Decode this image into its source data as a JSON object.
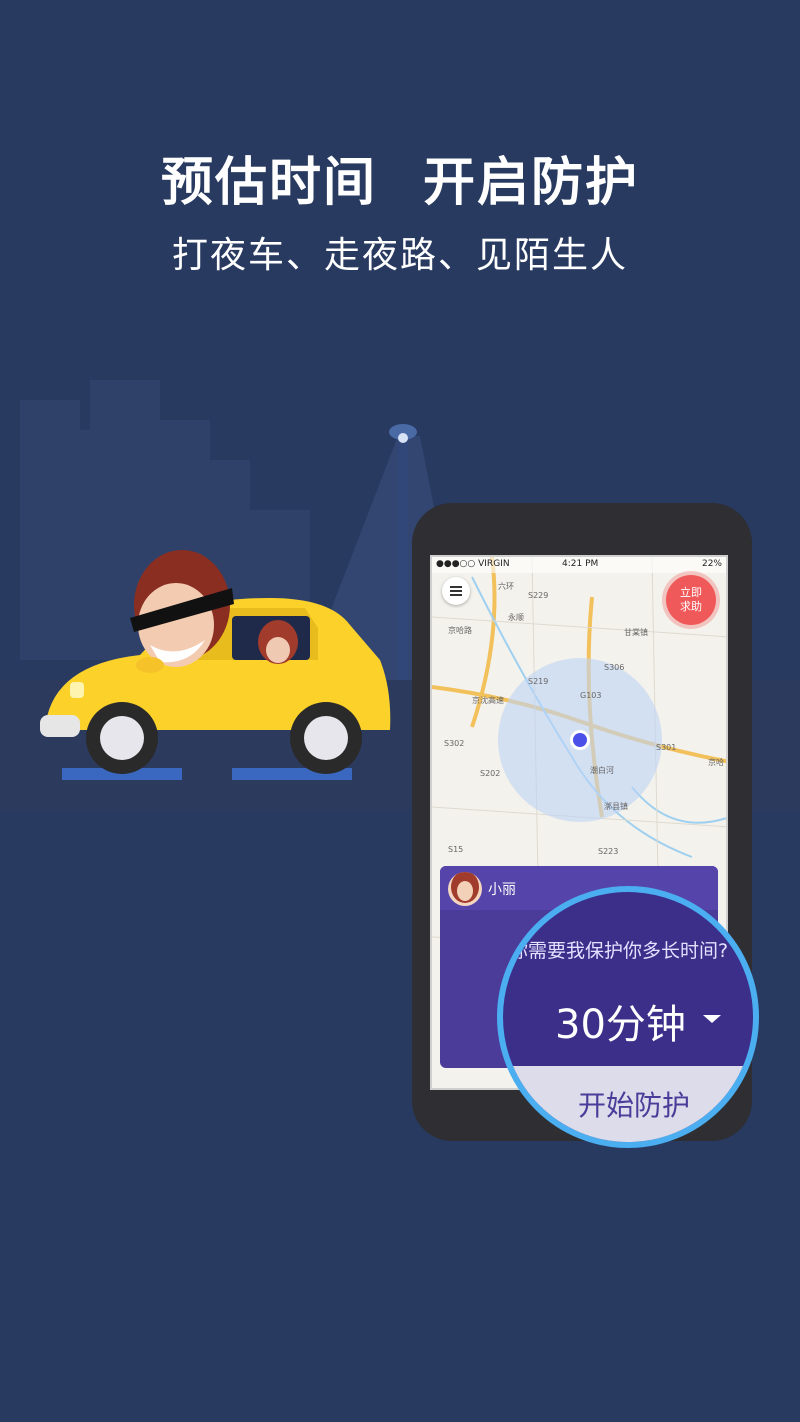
{
  "hero": {
    "headline_left": "预估时间",
    "headline_right": "开启防护",
    "subline": "打夜车、走夜路、见陌生人"
  },
  "phone": {
    "status": {
      "carrier": "●●●○○ VIRGIN",
      "time": "4:21 PM",
      "battery": "22%"
    },
    "sos_line1": "立即",
    "sos_line2": "求助",
    "map_labels": [
      "六环",
      "永顺",
      "京哈路",
      "甘棠镇",
      "京沈高速",
      "G103",
      "S302",
      "S301",
      "京哈",
      "潮白河",
      "漷县镇",
      "S202",
      "S229",
      "S306",
      "S15",
      "S223",
      "S219"
    ],
    "panel": {
      "contact_name": "小丽",
      "question": "你需要我保护你多长时间?",
      "duration": "30分钟",
      "start_button": "开始防护"
    }
  },
  "colors": {
    "background": "#283a60",
    "car_yellow": "#fcd22a",
    "panel_purple": "#4b3c9a",
    "magnifier_ring": "#4aaef0",
    "sos_red": "#f0595a"
  }
}
